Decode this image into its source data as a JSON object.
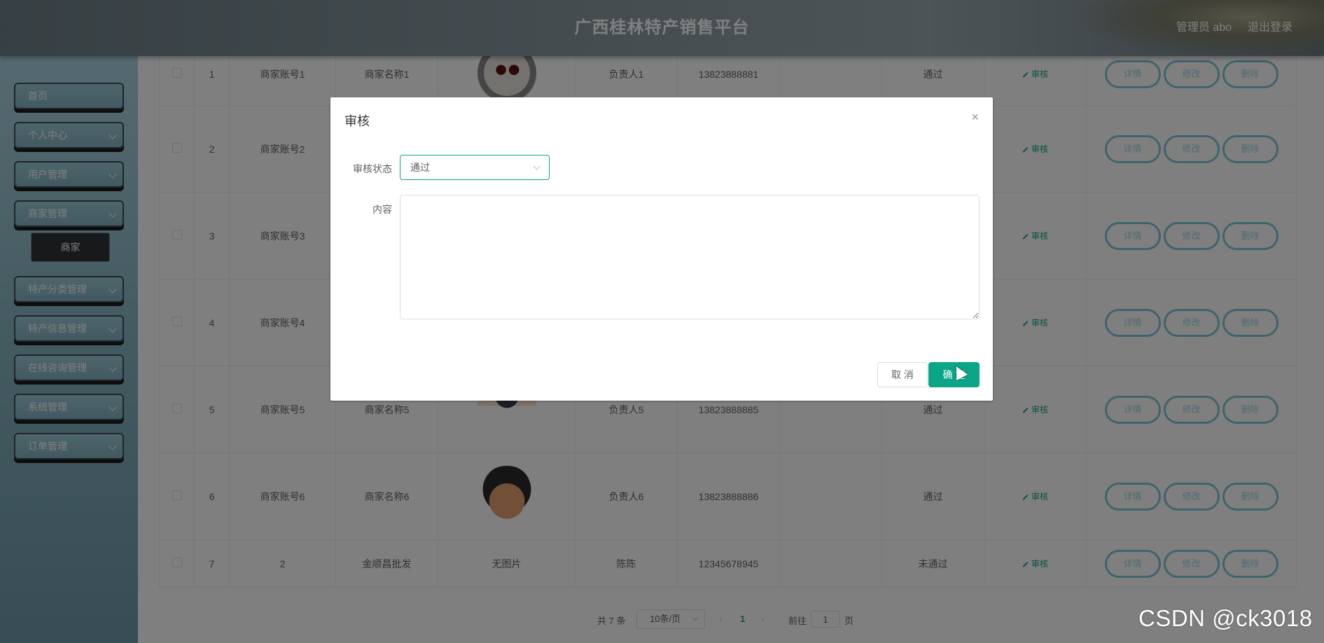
{
  "header": {
    "title": "广西桂林特产销售平台",
    "user": "管理员 abo",
    "logout": "退出登录"
  },
  "sidebar": {
    "items": [
      {
        "label": "首页",
        "chevron": false
      },
      {
        "label": "个人中心",
        "chevron": true
      },
      {
        "label": "用户管理",
        "chevron": true
      },
      {
        "label": "商家管理",
        "chevron": true
      },
      {
        "label": "特产分类管理",
        "chevron": true
      },
      {
        "label": "特产信息管理",
        "chevron": true
      },
      {
        "label": "在线咨询管理",
        "chevron": true
      },
      {
        "label": "系统管理",
        "chevron": true
      },
      {
        "label": "订单管理",
        "chevron": true
      }
    ],
    "submenu": "商家"
  },
  "table": {
    "rows": [
      {
        "index": "1",
        "account": "商家账号1",
        "name": "商家名称1",
        "image": "avatar-1",
        "contact": "负责人1",
        "phone": "13823888881",
        "reply": "",
        "status": "通过",
        "audit": "审核"
      },
      {
        "index": "2",
        "account": "商家账号2",
        "name": "",
        "image": "",
        "contact": "",
        "phone": "",
        "reply": "",
        "status": "",
        "audit": "审核"
      },
      {
        "index": "3",
        "account": "商家账号3",
        "name": "",
        "image": "",
        "contact": "",
        "phone": "",
        "reply": "",
        "status": "",
        "audit": "审核"
      },
      {
        "index": "4",
        "account": "商家账号4",
        "name": "",
        "image": "",
        "contact": "",
        "phone": "",
        "reply": "",
        "status": "",
        "audit": "审核"
      },
      {
        "index": "5",
        "account": "商家账号5",
        "name": "商家名称5",
        "image": "avatar-5",
        "contact": "负责人5",
        "phone": "13823888885",
        "reply": "",
        "status": "通过",
        "audit": "审核"
      },
      {
        "index": "6",
        "account": "商家账号6",
        "name": "商家名称6",
        "image": "avatar-6",
        "contact": "负责人6",
        "phone": "13823888886",
        "reply": "",
        "status": "通过",
        "audit": "审核"
      },
      {
        "index": "7",
        "account": "2",
        "name": "金顺昌批发",
        "image": "无图片",
        "contact": "陈陈",
        "phone": "12345678945",
        "reply": "",
        "status": "未通过",
        "audit": "审核"
      }
    ],
    "actions": {
      "detail": "详情",
      "edit": "修改",
      "delete": "删除"
    }
  },
  "pagination": {
    "total": "共 7 条",
    "page_size": "10条/页",
    "current_page": "1",
    "goto_label": "前往",
    "goto_value": "1",
    "page_suffix": "页"
  },
  "dialog": {
    "title": "审核",
    "close_icon": "×",
    "status_label": "审核状态",
    "status_value": "通过",
    "content_label": "内容",
    "content_value": "",
    "cancel": "取 消",
    "confirm": "确 定"
  },
  "watermark": "CSDN @ck3018",
  "colors": {
    "primary": "#0ba588",
    "action_border": "#7fc8d8",
    "sidebar_bg": "#88b4c2"
  }
}
